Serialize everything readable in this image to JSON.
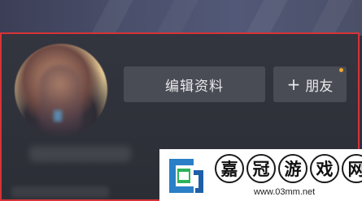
{
  "profile": {
    "edit_button_label": "编辑资料",
    "add_friend_label": "朋友",
    "add_friend_plus": "+",
    "notification_dot_color": "#f2a62d",
    "highlight_border_color": "#d73337"
  },
  "watermark": {
    "title_chars": [
      "嘉",
      "冠",
      "游",
      "戏",
      "网"
    ],
    "url": "www.03mm.net"
  },
  "icons": {
    "avatar": "user-avatar",
    "logo": "site-logo-icon"
  }
}
